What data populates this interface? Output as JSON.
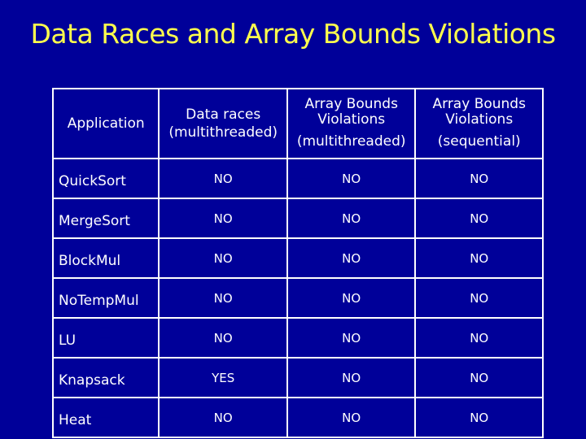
{
  "title": "Data Races and Array Bounds Violations",
  "table": {
    "headers": [
      {
        "line1": "Application",
        "line2": ""
      },
      {
        "line1": "Data races",
        "line2": "(multithreaded)"
      },
      {
        "line1": "Array Bounds Violations",
        "line2": "(multithreaded)"
      },
      {
        "line1": "Array Bounds Violations",
        "line2": "(sequential)"
      }
    ],
    "rows": [
      {
        "app": "QuickSort",
        "data_races": "NO",
        "abv_multi": "NO",
        "abv_seq": "NO"
      },
      {
        "app": "MergeSort",
        "data_races": "NO",
        "abv_multi": "NO",
        "abv_seq": "NO"
      },
      {
        "app": "BlockMul",
        "data_races": "NO",
        "abv_multi": "NO",
        "abv_seq": "NO"
      },
      {
        "app": "NoTempMul",
        "data_races": "NO",
        "abv_multi": "NO",
        "abv_seq": "NO"
      },
      {
        "app": "LU",
        "data_races": "NO",
        "abv_multi": "NO",
        "abv_seq": "NO"
      },
      {
        "app": "Knapsack",
        "data_races": "YES",
        "abv_multi": "NO",
        "abv_seq": "NO"
      },
      {
        "app": "Heat",
        "data_races": "NO",
        "abv_multi": "NO",
        "abv_seq": "NO"
      }
    ]
  },
  "colors": {
    "background": "#000099",
    "title": "#ffff4d",
    "text": "#ffffff"
  }
}
